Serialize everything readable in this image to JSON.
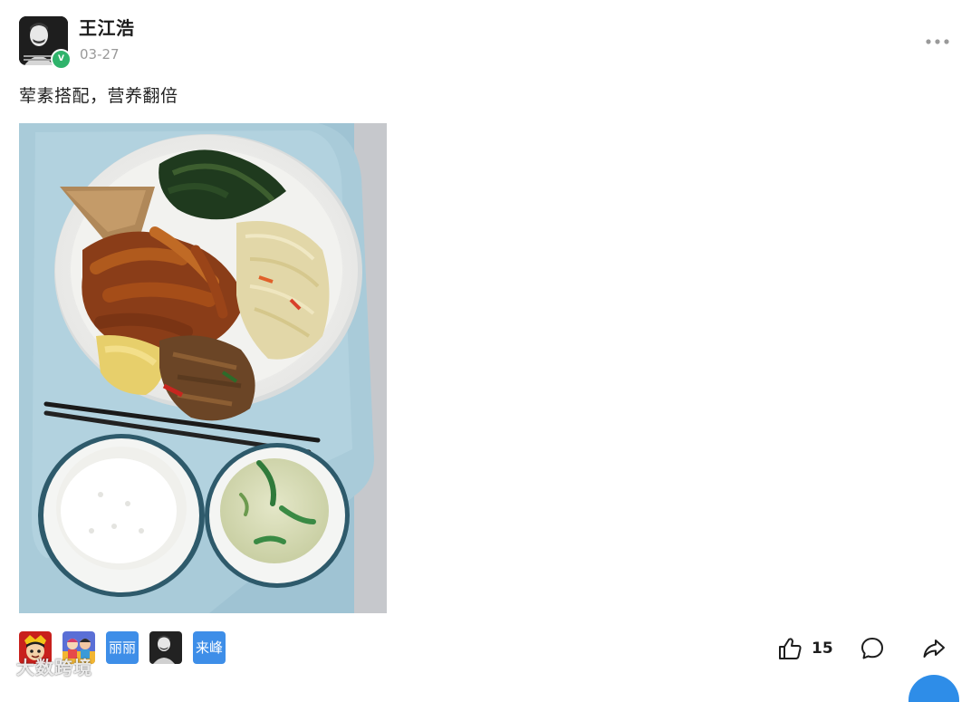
{
  "post": {
    "author": {
      "name": "王江浩",
      "verified_badge": "V"
    },
    "date": "03-27",
    "text": "荤素搭配，营养翻倍",
    "photo": {
      "subject": "meal-tray-photo"
    }
  },
  "reactors": {
    "items": [
      {
        "kind": "image",
        "icon": "cartoon-avatar"
      },
      {
        "kind": "image",
        "icon": "game-avatar"
      },
      {
        "kind": "text",
        "text": "丽丽"
      },
      {
        "kind": "image",
        "icon": "portrait-avatar"
      },
      {
        "kind": "text",
        "text": "来峰"
      }
    ]
  },
  "actions": {
    "like_count": "15",
    "like_icon": "thumbs-up-icon",
    "comment_icon": "comment-icon",
    "share_icon": "share-icon",
    "more_icon": "more-icon"
  },
  "watermark": {
    "text": "大数跨境"
  },
  "colors": {
    "accent": "#2e8de8",
    "verified": "#2fb36b",
    "date": "#9a9a9a"
  }
}
